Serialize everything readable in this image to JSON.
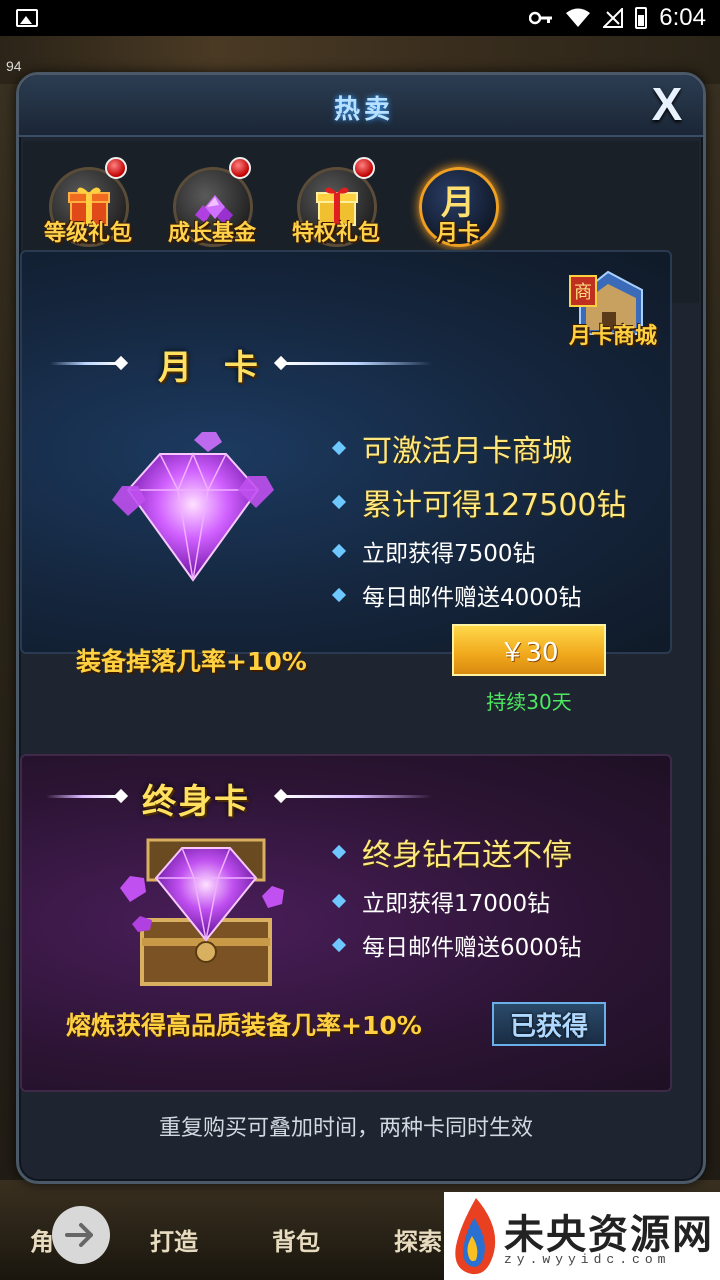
{
  "status_bar": {
    "time": "6:04"
  },
  "background": {
    "level": "94",
    "nav": [
      "角色",
      "打造",
      "背包",
      "探索"
    ]
  },
  "dialog": {
    "title": "热卖",
    "close_label": "X",
    "tabs": [
      {
        "label": "等级礼包",
        "has_badge": true,
        "icon": "gift-box-icon"
      },
      {
        "label": "成长基金",
        "has_badge": true,
        "icon": "gem-pile-icon"
      },
      {
        "label": "特权礼包",
        "has_badge": true,
        "icon": "gift-box-icon"
      },
      {
        "label": "月卡",
        "has_badge": false,
        "icon": "month-card-icon",
        "icon_char": "月",
        "active": true
      }
    ],
    "month_card": {
      "title": "月 卡",
      "shop_label": "月卡商城",
      "shop_sign": "商",
      "features": [
        "可激活月卡商城",
        "累计可得127500钻",
        "立即获得7500钻",
        "每日邮件赠送4000钻"
      ],
      "bonus": "装备掉落几率+10%",
      "price": "￥30",
      "duration": "持续30天"
    },
    "lifetime_card": {
      "title": "终身卡",
      "features": [
        "终身钻石送不停",
        "立即获得17000钻",
        "每日邮件赠送6000钻"
      ],
      "bonus": "熔炼获得高品质装备几率+10%",
      "status": "已获得"
    },
    "footnote": "重复购买可叠加时间，两种卡同时生效"
  },
  "watermark": {
    "text": "未央资源网",
    "url": "zy.wyyidc.com"
  },
  "colors": {
    "gold_text": "#ffe060",
    "dialog_bg": "#1e2530",
    "price_button": "#f0a81c",
    "duration_green": "#4ce860"
  }
}
